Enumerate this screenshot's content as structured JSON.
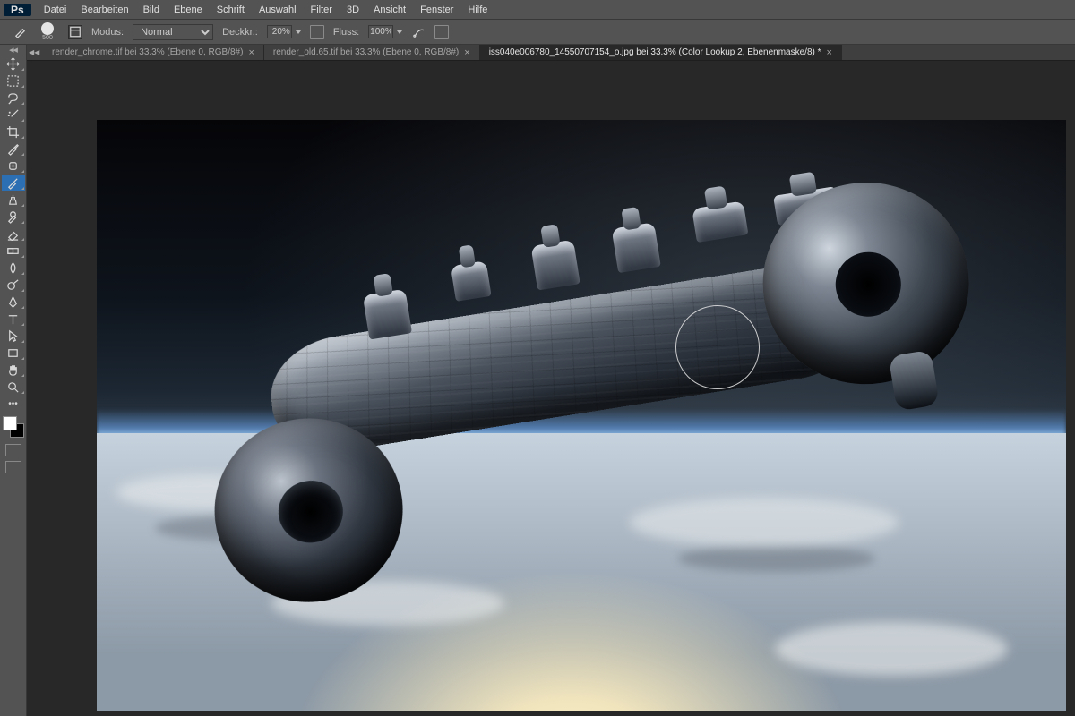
{
  "app": {
    "logo": "Ps"
  },
  "menubar": {
    "items": [
      "Datei",
      "Bearbeiten",
      "Bild",
      "Ebene",
      "Schrift",
      "Auswahl",
      "Filter",
      "3D",
      "Ansicht",
      "Fenster",
      "Hilfe"
    ]
  },
  "options": {
    "brush_size": "500",
    "mode_label": "Modus:",
    "mode_value": "Normal",
    "opacity_label": "Deckkr.:",
    "opacity_value": "20%",
    "flow_label": "Fluss:",
    "flow_value": "100%"
  },
  "tabs": [
    {
      "label": "render_chrome.tif bei 33.3% (Ebene 0, RGB/8#)",
      "active": false,
      "close": "×"
    },
    {
      "label": "render_old.65.tif bei 33.3% (Ebene 0, RGB/8#)",
      "active": false,
      "close": "×"
    },
    {
      "label": "iss040e006780_14550707154_o.jpg bei 33.3%  (Color Lookup 2, Ebenenmaske/8) *",
      "active": true,
      "close": "×"
    }
  ],
  "tools": {
    "active": "brush"
  }
}
